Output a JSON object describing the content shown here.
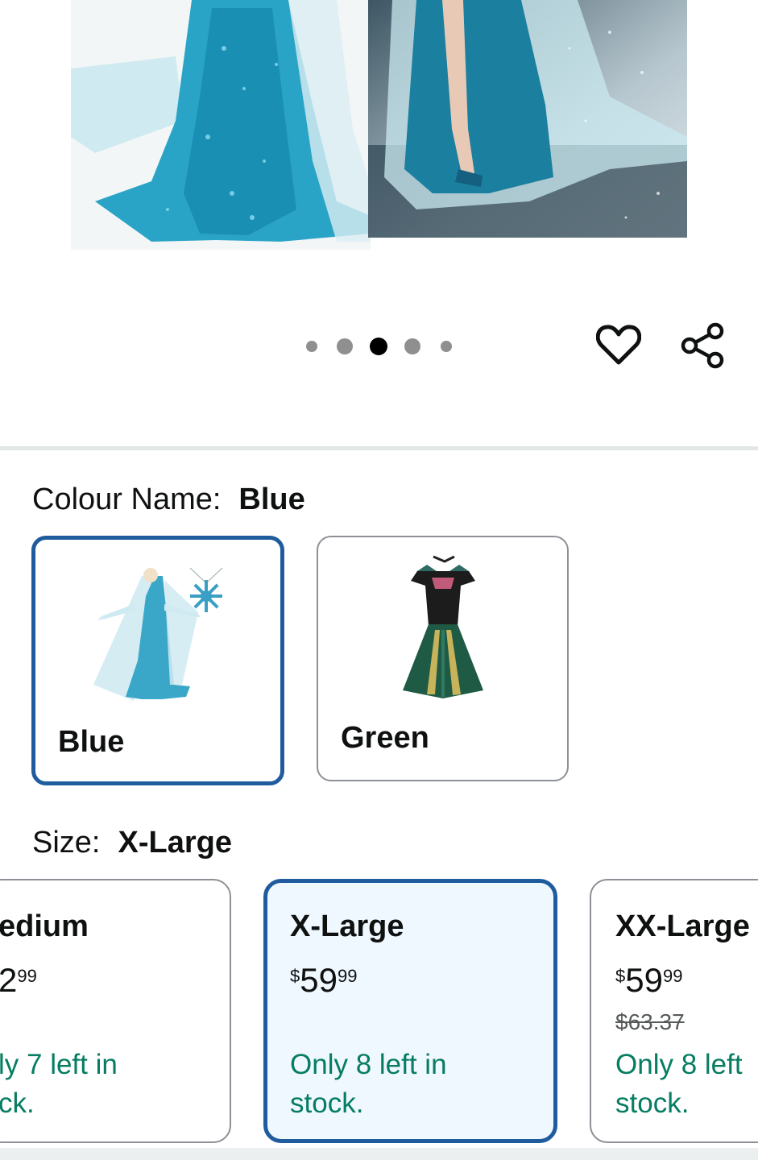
{
  "gallery": {
    "image_count": 5,
    "active_index": 2,
    "wishlist_icon": "heart-icon",
    "share_icon": "share-icon"
  },
  "colour": {
    "label": "Colour Name:",
    "selected": "Blue",
    "options": [
      {
        "label": "Blue",
        "selected": true
      },
      {
        "label": "Green",
        "selected": false
      }
    ]
  },
  "size": {
    "label": "Size:",
    "selected": "X-Large",
    "options": [
      {
        "name": "edium",
        "price_whole": "2",
        "price_frac": "99",
        "stock_line1": "ly 7 left in",
        "stock_line2": "ck."
      },
      {
        "name": "X-Large",
        "price_currency": "$",
        "price_whole": "59",
        "price_frac": "99",
        "stock_line1": "Only 8 left in",
        "stock_line2": "stock."
      },
      {
        "name": "XX-Large",
        "price_currency": "$",
        "price_whole": "59",
        "price_frac": "99",
        "was_price": "$63.37",
        "stock_line1": "Only 8 left",
        "stock_line2": "stock."
      }
    ]
  },
  "colors": {
    "selected_border": "#1f5c9e",
    "selected_bg": "#f0f8ff",
    "stock_green": "#067d62"
  }
}
